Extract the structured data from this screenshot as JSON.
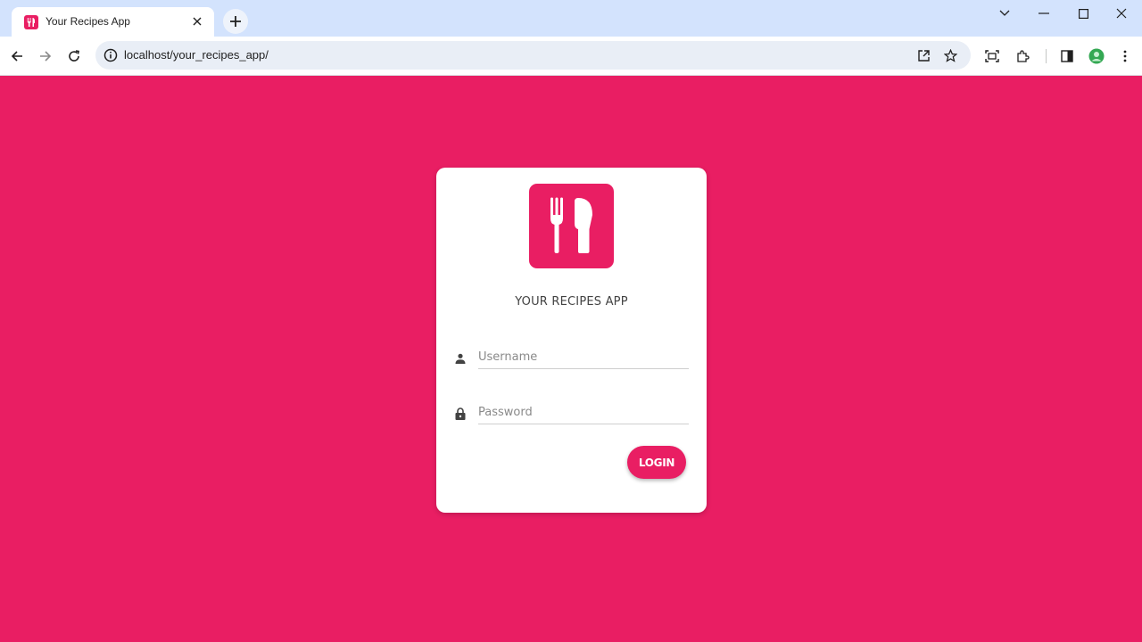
{
  "browser": {
    "tab_title": "Your Recipes App",
    "url": "localhost/your_recipes_app/"
  },
  "colors": {
    "brand": "#e91e63",
    "chrome_tabstrip": "#d3e3fd",
    "card": "#ffffff"
  },
  "login": {
    "logo_icon": "fork-knife-icon",
    "app_title": "YOUR RECIPES APP",
    "username_placeholder": "Username",
    "password_placeholder": "Password",
    "login_label": "LOGIN"
  }
}
